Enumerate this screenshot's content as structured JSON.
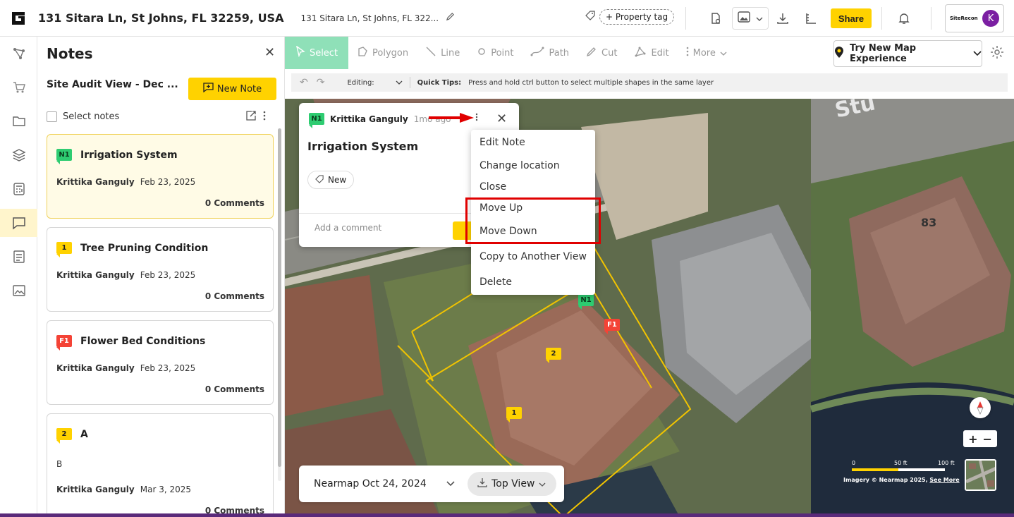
{
  "header": {
    "address_main": "131 Sitara Ln, St Johns, FL 32259, USA",
    "address_sub": "131 Sitara Ln, St Johns, FL 322...",
    "property_tag_label": "+ Property tag",
    "share_label": "Share",
    "brand_mini": "SiteRecon",
    "avatar_initial": "K"
  },
  "notes_panel": {
    "title": "Notes",
    "view_name": "Site Audit View - Dec ...",
    "new_note_label": "New Note",
    "select_label": "Select notes",
    "cards": [
      {
        "badge": "N1",
        "title": "Irrigation System",
        "author": "Krittika Ganguly",
        "date": "Feb 23, 2025",
        "comments": "0 Comments",
        "body": ""
      },
      {
        "badge": "1",
        "title": "Tree Pruning Condition",
        "author": "Krittika Ganguly",
        "date": "Feb 23, 2025",
        "comments": "0 Comments",
        "body": ""
      },
      {
        "badge": "F1",
        "title": "Flower Bed Conditions",
        "author": "Krittika Ganguly",
        "date": "Feb 23, 2025",
        "comments": "0 Comments",
        "body": ""
      },
      {
        "badge": "2",
        "title": "A",
        "author": "Krittika Ganguly",
        "date": "Mar 3, 2025",
        "comments": "0 Comments",
        "body": "B"
      }
    ]
  },
  "toolbar": {
    "tools": [
      "Select",
      "Polygon",
      "Line",
      "Point",
      "Path",
      "Cut",
      "Edit",
      "More"
    ],
    "try_map_label": "Try New Map Experience"
  },
  "tips": {
    "editing_label": "Editing:",
    "quick_tips_label": "Quick Tips:",
    "quick_tips_text": "Press and hold ctrl button to select multiple shapes in the same layer"
  },
  "popup": {
    "badge": "N1",
    "author": "Krittika Ganguly",
    "time": "1mo ago",
    "title": "Irrigation System",
    "tag": "New",
    "comment_placeholder": "Add a comment"
  },
  "menu": {
    "items": [
      "Edit Note",
      "Change location",
      "Close",
      "Move Up",
      "Move Down",
      "Copy to Another View",
      "Delete"
    ]
  },
  "datebar": {
    "date_label": "Nearmap Oct 24, 2024",
    "view_label": "Top View"
  },
  "map": {
    "markers": [
      "N1",
      "F1",
      "2",
      "1"
    ],
    "house_number": "83",
    "street_text": "Stu",
    "scale_labels": [
      "0",
      "50 ft",
      "100 ft"
    ],
    "credit_text": "Imagery © Nearmap 2025,",
    "see_more": "See More"
  },
  "colors": {
    "accent": "#ffd200",
    "select_active": "#8fe0b8",
    "highlight_red": "#e00000",
    "avatar": "#7b1fa2"
  }
}
